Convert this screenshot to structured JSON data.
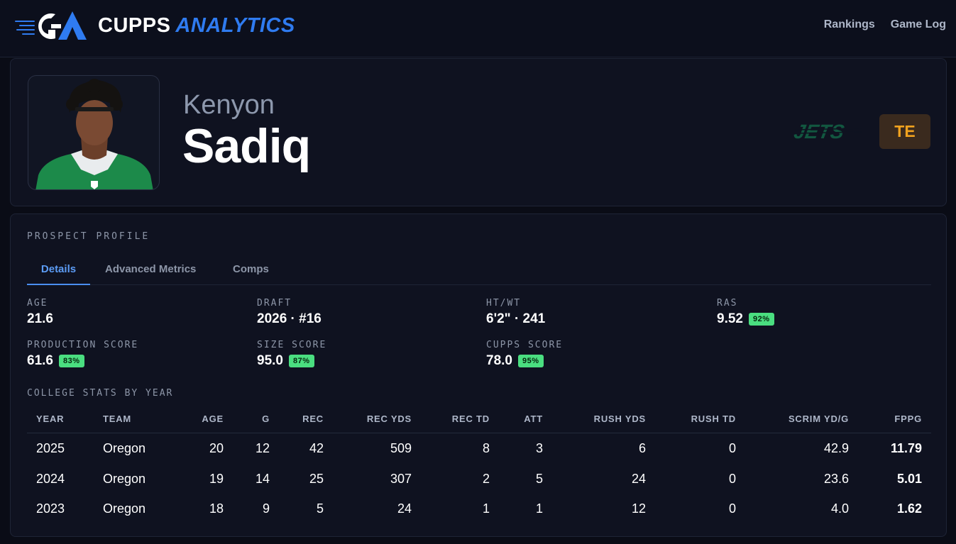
{
  "brand": {
    "word1": "CUPPS",
    "word2": "ANALYTICS"
  },
  "nav": {
    "links": [
      "Rankings",
      "Game Log"
    ]
  },
  "player": {
    "first_name": "Kenyon",
    "last_name": "Sadiq",
    "team_logo_text": "JETS",
    "position": "TE"
  },
  "profile": {
    "section_title": "PROSPECT PROFILE",
    "tabs": [
      "Details",
      "Advanced Metrics",
      "Comps"
    ],
    "active_tab": "Details",
    "details": {
      "age": {
        "label": "AGE",
        "value": "21.6"
      },
      "draft": {
        "label": "DRAFT",
        "value": "2026 · #16"
      },
      "htwt": {
        "label": "HT/WT",
        "value": "6'2\" · 241"
      },
      "ras": {
        "label": "RAS",
        "value": "9.52",
        "pct": "92%"
      },
      "production": {
        "label": "PRODUCTION SCORE",
        "value": "61.6",
        "pct": "83%"
      },
      "size": {
        "label": "SIZE SCORE",
        "value": "95.0",
        "pct": "87%"
      },
      "cupps": {
        "label": "CUPPS SCORE",
        "value": "78.0",
        "pct": "95%"
      }
    },
    "college_title": "COLLEGE STATS BY YEAR",
    "table": {
      "headers": [
        "YEAR",
        "TEAM",
        "AGE",
        "G",
        "REC",
        "REC YDS",
        "REC TD",
        "ATT",
        "RUSH YDS",
        "RUSH TD",
        "SCRIM YD/G",
        "FPPG"
      ],
      "rows": [
        [
          "2025",
          "Oregon",
          "20",
          "12",
          "42",
          "509",
          "8",
          "3",
          "6",
          "0",
          "42.9",
          "11.79"
        ],
        [
          "2024",
          "Oregon",
          "19",
          "14",
          "25",
          "307",
          "2",
          "5",
          "24",
          "0",
          "23.6",
          "5.01"
        ],
        [
          "2023",
          "Oregon",
          "18",
          "9",
          "5",
          "24",
          "1",
          "1",
          "12",
          "0",
          "4.0",
          "1.62"
        ]
      ]
    }
  },
  "colors": {
    "accent": "#2f7bf0",
    "badge_green": "#4ade80",
    "position_orange": "#f0a21f",
    "jets_green": "#125740"
  }
}
